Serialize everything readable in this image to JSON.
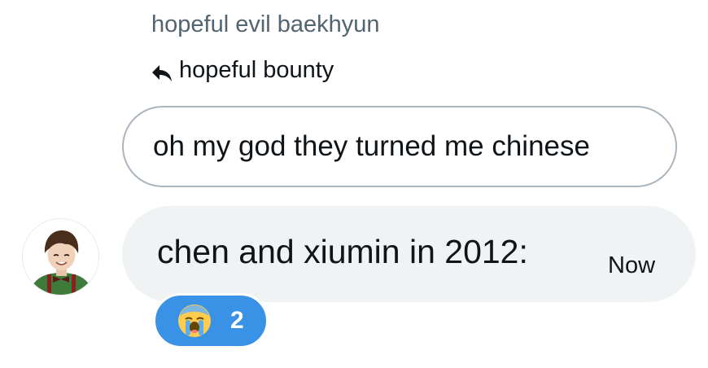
{
  "message": {
    "sender_name": "hopeful evil baekhyun",
    "reply_to_name": "hopeful bounty",
    "reply_icon": "reply-arrow-icon",
    "quoted_text": "oh my god they turned me chinese",
    "text": "chen and xiumin in 2012:",
    "timestamp": "Now",
    "avatar_icon": "user-avatar"
  },
  "reaction": {
    "emoji_icon": "loudly-crying-face-emoji",
    "count": "2"
  },
  "colors": {
    "sender_name": "#536471",
    "text": "#0f1419",
    "bubble_background": "#eff3f4",
    "quoted_border": "#aab4bd",
    "reaction_pill": "#3a92e6",
    "reaction_count": "#ffffff"
  }
}
